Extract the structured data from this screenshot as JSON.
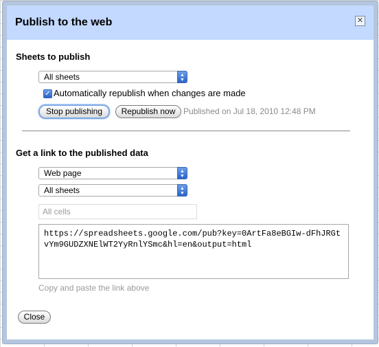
{
  "dialog": {
    "title": "Publish to the web",
    "close_glyph": "✕"
  },
  "publish": {
    "heading": "Sheets to publish",
    "sheet_select": "All sheets",
    "auto_republish_label": "Automatically republish when changes are made",
    "auto_republish_checked": true,
    "stop_button": "Stop publishing",
    "republish_button": "Republish now",
    "status": "Published on Jul 18, 2010 12:48 PM"
  },
  "link": {
    "heading": "Get a link to the published data",
    "format_select": "Web page",
    "sheet_select": "All sheets",
    "cells_placeholder": "All cells",
    "url": "https://spreadsheets.google.com/pub?key=0ArtFa8eBGIw-dFhJRGtvYm9GUDZXNElWT2YyRnlYSmc&hl=en&output=html",
    "hint": "Copy and paste the link above"
  },
  "footer": {
    "close_button": "Close"
  },
  "colors": {
    "titlebar": "#c3d9ff",
    "dialog_border": "#b3c6dd",
    "accent_blue": "#2a62c9"
  }
}
